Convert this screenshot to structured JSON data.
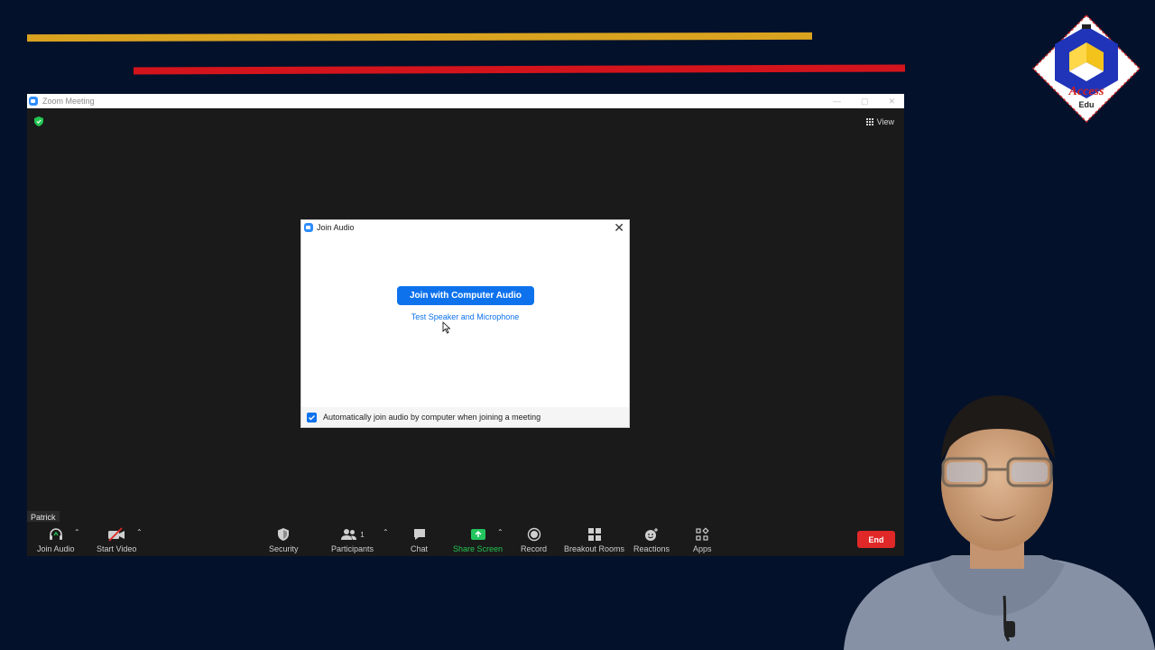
{
  "window": {
    "title": "Zoom Meeting"
  },
  "top_bar": {
    "view_label": "View"
  },
  "participant": {
    "name": "Patrick"
  },
  "dialog": {
    "title": "Join Audio",
    "join_button": "Join with Computer Audio",
    "test_link": "Test Speaker and Microphone",
    "auto_join_label": "Automatically join audio by computer when joining a meeting",
    "auto_join_checked": true
  },
  "toolbar": {
    "join_audio": "Join Audio",
    "start_video": "Start Video",
    "security": "Security",
    "participants": "Participants",
    "participants_count": "1",
    "chat": "Chat",
    "share_screen": "Share Screen",
    "record": "Record",
    "breakout_rooms": "Breakout Rooms",
    "reactions": "Reactions",
    "apps": "Apps",
    "end": "End"
  },
  "logo": {
    "text_primary": "Access",
    "text_secondary": "Edu"
  },
  "colors": {
    "background": "#04112a",
    "stripe_gold": "#d9a320",
    "stripe_red": "#d3141c",
    "zoom_blue": "#0e72ed",
    "share_green": "#22c55e",
    "end_red": "#e02828"
  }
}
